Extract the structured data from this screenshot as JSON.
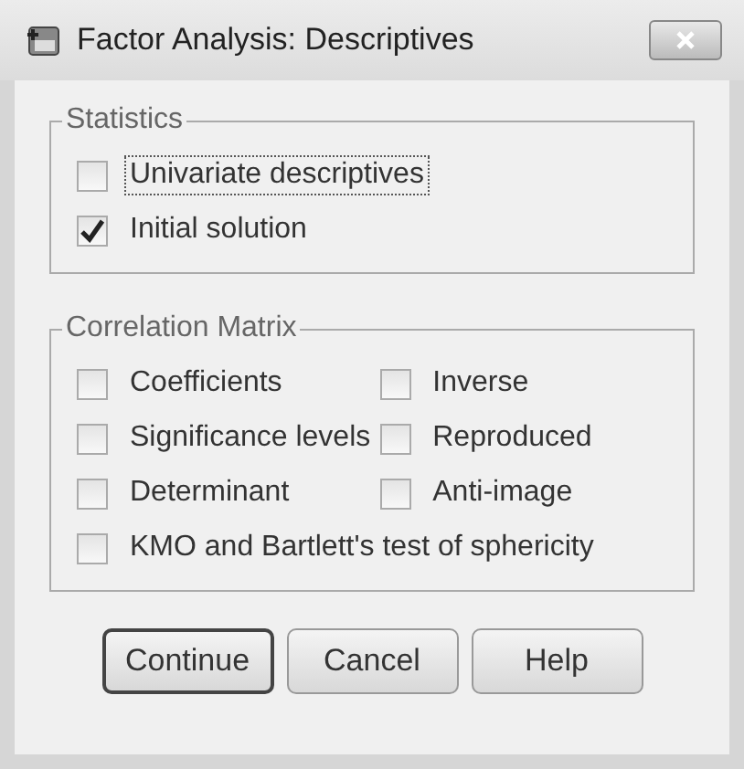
{
  "window": {
    "title": "Factor Analysis: Descriptives"
  },
  "statistics": {
    "title": "Statistics",
    "items": [
      {
        "label": "Univariate descriptives",
        "checked": false,
        "focused": true
      },
      {
        "label": "Initial solution",
        "checked": true,
        "focused": false
      }
    ]
  },
  "correlation_matrix": {
    "title": "Correlation Matrix",
    "rows": [
      [
        {
          "label": "Coefficients",
          "checked": false
        },
        {
          "label": "Inverse",
          "checked": false
        }
      ],
      [
        {
          "label": "Significance levels",
          "checked": false
        },
        {
          "label": "Reproduced",
          "checked": false
        }
      ],
      [
        {
          "label": "Determinant",
          "checked": false
        },
        {
          "label": "Anti-image",
          "checked": false
        }
      ],
      [
        {
          "label": "KMO and Bartlett's test of sphericity",
          "checked": false
        }
      ]
    ]
  },
  "buttons": [
    {
      "label": "Continue",
      "default": true
    },
    {
      "label": "Cancel",
      "default": false
    },
    {
      "label": "Help",
      "default": false
    }
  ]
}
